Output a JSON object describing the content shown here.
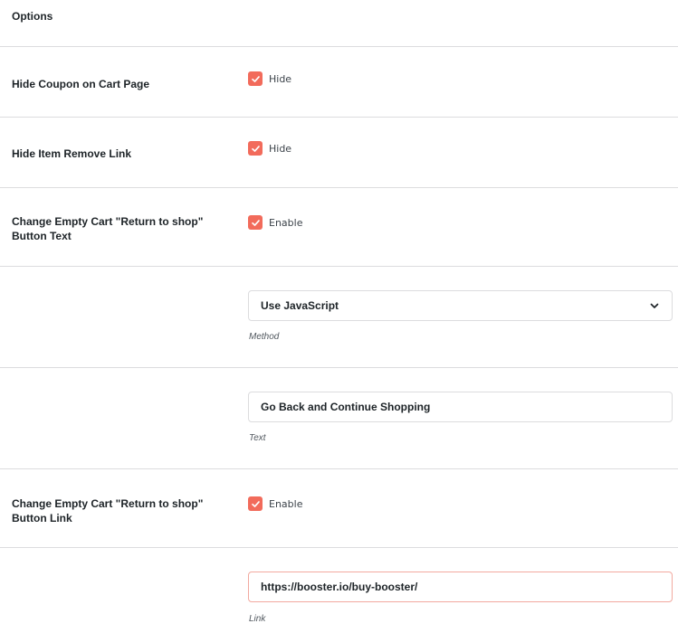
{
  "section": {
    "title": "Options"
  },
  "rows": [
    {
      "label": "Hide Coupon on Cart Page",
      "checkbox_label": "Hide",
      "checked": true
    },
    {
      "label": "Hide Item Remove Link",
      "checkbox_label": "Hide",
      "checked": true
    },
    {
      "label": "Change Empty Cart \"Return to shop\" Button Text",
      "checkbox_label": "Enable",
      "checked": true
    },
    {
      "label": "",
      "select_value": "Use JavaScript",
      "hint": "Method"
    },
    {
      "label": "",
      "input_value": "Go Back and Continue Shopping",
      "hint": "Text"
    },
    {
      "label": "Change Empty Cart \"Return to shop\" Button Link",
      "checkbox_label": "Enable",
      "checked": true
    },
    {
      "label": "",
      "input_value": "https://booster.io/buy-booster/",
      "hint": "Link"
    }
  ],
  "colors": {
    "accent": "#f26b5b",
    "divider": "#dcdcde",
    "text": "#1d2327",
    "link_field_border": "#f2a99f"
  },
  "icons": {
    "checkbox": "checkmark-icon",
    "select": "chevron-down-icon"
  }
}
